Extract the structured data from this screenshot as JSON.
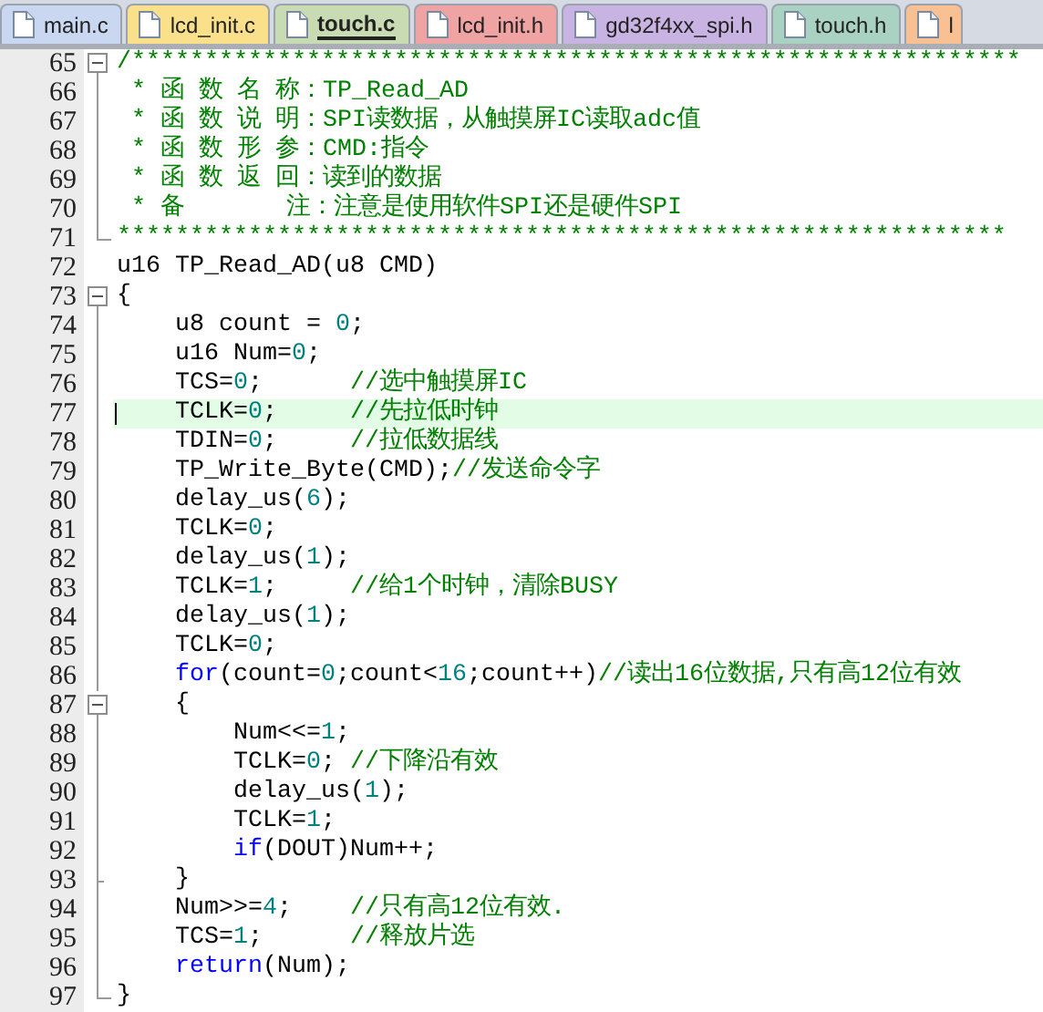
{
  "tabs": [
    {
      "label": "main.c",
      "color": "#c9d7f0",
      "selected": false
    },
    {
      "label": "lcd_init.c",
      "color": "#fbe08c",
      "selected": false
    },
    {
      "label": "touch.c",
      "color": "#c9dbb2",
      "selected": true
    },
    {
      "label": "lcd_init.h",
      "color": "#f0a3a3",
      "selected": false
    },
    {
      "label": "gd32f4xx_spi.h",
      "color": "#c9b3e3",
      "selected": false
    },
    {
      "label": "touch.h",
      "color": "#a9d2c2",
      "selected": false
    },
    {
      "label": "l",
      "color": "#f9c193",
      "selected": false
    }
  ],
  "lines": [
    {
      "number": "65",
      "kind": "start",
      "current": false,
      "segments": [
        {
          "text": "/*************************************************************",
          "kind": "comment"
        }
      ]
    },
    {
      "number": "66",
      "kind": "body",
      "current": false,
      "segments": [
        {
          "text": " * 函 数 名 称：TP_Read_AD",
          "kind": "comment"
        }
      ]
    },
    {
      "number": "67",
      "kind": "body",
      "current": false,
      "segments": [
        {
          "text": " * 函 数 说 明：SPI读数据，从触摸屏IC读取adc值",
          "kind": "comment"
        }
      ]
    },
    {
      "number": "68",
      "kind": "body",
      "current": false,
      "segments": [
        {
          "text": " * 函 数 形 参：CMD:指令",
          "kind": "comment"
        }
      ]
    },
    {
      "number": "69",
      "kind": "body",
      "current": false,
      "segments": [
        {
          "text": " * 函 数 返 回：读到的数据",
          "kind": "comment"
        }
      ]
    },
    {
      "number": "70",
      "kind": "body",
      "current": false,
      "segments": [
        {
          "text": " * 备       注：注意是使用软件SPI还是硬件SPI",
          "kind": "comment"
        }
      ]
    },
    {
      "number": "71",
      "kind": "end",
      "current": false,
      "segments": [
        {
          "text": "*************************************************************",
          "kind": "comment"
        }
      ]
    },
    {
      "number": "72",
      "kind": "plain",
      "current": false,
      "segments": [
        {
          "text": "u16 TP_Read_AD(u8 CMD)",
          "kind": "code"
        }
      ]
    },
    {
      "number": "73",
      "kind": "start",
      "current": false,
      "segments": [
        {
          "text": "{",
          "kind": "code"
        }
      ]
    },
    {
      "number": "74",
      "kind": "body",
      "current": false,
      "segments": [
        {
          "text": "    u8 count = ",
          "kind": "code"
        },
        {
          "text": "0",
          "kind": "number"
        },
        {
          "text": ";",
          "kind": "code"
        }
      ]
    },
    {
      "number": "75",
      "kind": "body",
      "current": false,
      "segments": [
        {
          "text": "    u16 Num=",
          "kind": "code"
        },
        {
          "text": "0",
          "kind": "number"
        },
        {
          "text": ";",
          "kind": "code"
        }
      ]
    },
    {
      "number": "76",
      "kind": "body",
      "current": false,
      "segments": [
        {
          "text": "    TCS=",
          "kind": "code"
        },
        {
          "text": "0",
          "kind": "number"
        },
        {
          "text": ";      ",
          "kind": "code"
        },
        {
          "text": "//选中触摸屏IC",
          "kind": "comment"
        }
      ]
    },
    {
      "number": "77",
      "kind": "body",
      "current": true,
      "segments": [
        {
          "text": "    TCLK=",
          "kind": "code"
        },
        {
          "text": "0",
          "kind": "number"
        },
        {
          "text": ";     ",
          "kind": "code"
        },
        {
          "text": "//先拉低时钟",
          "kind": "comment"
        }
      ]
    },
    {
      "number": "78",
      "kind": "body",
      "current": false,
      "segments": [
        {
          "text": "    TDIN=",
          "kind": "code"
        },
        {
          "text": "0",
          "kind": "number"
        },
        {
          "text": ";     ",
          "kind": "code"
        },
        {
          "text": "//拉低数据线",
          "kind": "comment"
        }
      ]
    },
    {
      "number": "79",
      "kind": "body",
      "current": false,
      "segments": [
        {
          "text": "    TP_Write_Byte(CMD);",
          "kind": "code"
        },
        {
          "text": "//发送命令字",
          "kind": "comment"
        }
      ]
    },
    {
      "number": "80",
      "kind": "body",
      "current": false,
      "segments": [
        {
          "text": "    delay_us(",
          "kind": "code"
        },
        {
          "text": "6",
          "kind": "number"
        },
        {
          "text": ");",
          "kind": "code"
        }
      ]
    },
    {
      "number": "81",
      "kind": "body",
      "current": false,
      "segments": [
        {
          "text": "    TCLK=",
          "kind": "code"
        },
        {
          "text": "0",
          "kind": "number"
        },
        {
          "text": ";",
          "kind": "code"
        }
      ]
    },
    {
      "number": "82",
      "kind": "body",
      "current": false,
      "segments": [
        {
          "text": "    delay_us(",
          "kind": "code"
        },
        {
          "text": "1",
          "kind": "number"
        },
        {
          "text": ");",
          "kind": "code"
        }
      ]
    },
    {
      "number": "83",
      "kind": "body",
      "current": false,
      "segments": [
        {
          "text": "    TCLK=",
          "kind": "code"
        },
        {
          "text": "1",
          "kind": "number"
        },
        {
          "text": ";     ",
          "kind": "code"
        },
        {
          "text": "//给1个时钟，清除BUSY",
          "kind": "comment"
        }
      ]
    },
    {
      "number": "84",
      "kind": "body",
      "current": false,
      "segments": [
        {
          "text": "    delay_us(",
          "kind": "code"
        },
        {
          "text": "1",
          "kind": "number"
        },
        {
          "text": ");",
          "kind": "code"
        }
      ]
    },
    {
      "number": "85",
      "kind": "body",
      "current": false,
      "segments": [
        {
          "text": "    TCLK=",
          "kind": "code"
        },
        {
          "text": "0",
          "kind": "number"
        },
        {
          "text": ";",
          "kind": "code"
        }
      ]
    },
    {
      "number": "86",
      "kind": "body",
      "current": false,
      "segments": [
        {
          "text": "    for",
          "kind": "keyword"
        },
        {
          "text": "(count=",
          "kind": "code"
        },
        {
          "text": "0",
          "kind": "number"
        },
        {
          "text": ";count<",
          "kind": "code"
        },
        {
          "text": "16",
          "kind": "number"
        },
        {
          "text": ";count++)",
          "kind": "code"
        },
        {
          "text": "//读出16位数据,只有高12位有效",
          "kind": "comment"
        }
      ]
    },
    {
      "number": "87",
      "kind": "start",
      "current": false,
      "segments": [
        {
          "text": "    {",
          "kind": "code"
        }
      ]
    },
    {
      "number": "88",
      "kind": "body",
      "current": false,
      "segments": [
        {
          "text": "        Num<<=",
          "kind": "code"
        },
        {
          "text": "1",
          "kind": "number"
        },
        {
          "text": ";",
          "kind": "code"
        }
      ]
    },
    {
      "number": "89",
      "kind": "body",
      "current": false,
      "segments": [
        {
          "text": "        TCLK=",
          "kind": "code"
        },
        {
          "text": "0",
          "kind": "number"
        },
        {
          "text": "; ",
          "kind": "code"
        },
        {
          "text": "//下降沿有效",
          "kind": "comment"
        }
      ]
    },
    {
      "number": "90",
      "kind": "body",
      "current": false,
      "segments": [
        {
          "text": "        delay_us(",
          "kind": "code"
        },
        {
          "text": "1",
          "kind": "number"
        },
        {
          "text": ");",
          "kind": "code"
        }
      ]
    },
    {
      "number": "91",
      "kind": "body",
      "current": false,
      "segments": [
        {
          "text": "        TCLK=",
          "kind": "code"
        },
        {
          "text": "1",
          "kind": "number"
        },
        {
          "text": ";",
          "kind": "code"
        }
      ]
    },
    {
      "number": "92",
      "kind": "body",
      "current": false,
      "segments": [
        {
          "text": "        if",
          "kind": "keyword"
        },
        {
          "text": "(DOUT)Num++;",
          "kind": "code"
        }
      ]
    },
    {
      "number": "93",
      "kind": "inner-end",
      "current": false,
      "segments": [
        {
          "text": "    }",
          "kind": "code"
        }
      ]
    },
    {
      "number": "94",
      "kind": "body",
      "current": false,
      "segments": [
        {
          "text": "    Num>>=",
          "kind": "code"
        },
        {
          "text": "4",
          "kind": "number"
        },
        {
          "text": ";    ",
          "kind": "code"
        },
        {
          "text": "//只有高12位有效.",
          "kind": "comment"
        }
      ]
    },
    {
      "number": "95",
      "kind": "body",
      "current": false,
      "segments": [
        {
          "text": "    TCS=",
          "kind": "code"
        },
        {
          "text": "1",
          "kind": "number"
        },
        {
          "text": ";      ",
          "kind": "code"
        },
        {
          "text": "//释放片选",
          "kind": "comment"
        }
      ]
    },
    {
      "number": "96",
      "kind": "body",
      "current": false,
      "segments": [
        {
          "text": "    return",
          "kind": "keyword"
        },
        {
          "text": "(Num);",
          "kind": "code"
        }
      ]
    },
    {
      "number": "97",
      "kind": "end",
      "current": false,
      "segments": [
        {
          "text": "}",
          "kind": "code"
        }
      ]
    }
  ]
}
